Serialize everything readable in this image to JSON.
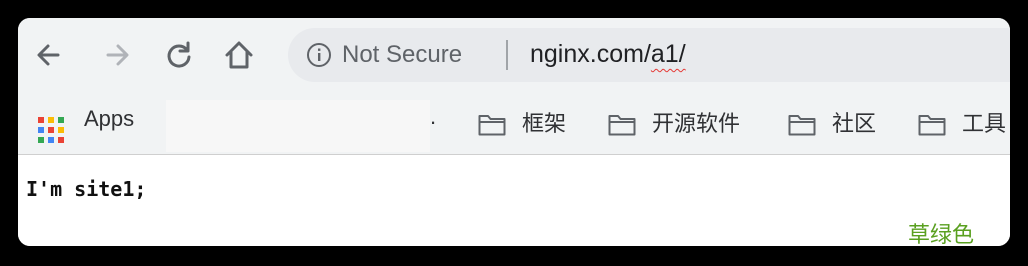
{
  "toolbar": {
    "security_text": "Not Secure",
    "url_host": "nginx.com/",
    "url_path": "a1/"
  },
  "bookmarks": {
    "apps_label": "Apps",
    "dot": ".",
    "items": [
      {
        "label": "框架",
        "icon": "folder-icon"
      },
      {
        "label": "开源软件",
        "icon": "folder-icon"
      },
      {
        "label": "社区",
        "icon": "folder-icon"
      },
      {
        "label": "工具",
        "icon": "folder-icon"
      }
    ]
  },
  "page": {
    "body_text": "I'm site1;"
  },
  "caption": "草绿色",
  "colors": {
    "caption": "#5aa020",
    "url_underline": "#e53935",
    "toolbar_bg": "#f1f3f4"
  }
}
